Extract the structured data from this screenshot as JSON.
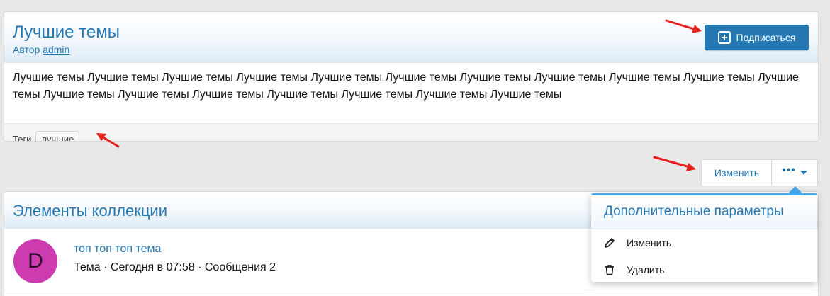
{
  "thread": {
    "title": "Лучшие темы",
    "byline_prefix": "Автор",
    "author": "admin",
    "subscribe_label": "Подписаться",
    "body": "Лучшие темы Лучшие темы Лучшие темы Лучшие темы Лучшие темы Лучшие темы Лучшие темы Лучшие темы Лучшие темы Лучшие темы Лучшие темы Лучшие темы Лучшие темы Лучшие темы Лучшие темы Лучшие темы Лучшие темы Лучшие темы",
    "tags_label": "Теги",
    "tags": [
      "лучшие"
    ]
  },
  "actions": {
    "edit_label": "Изменить",
    "more_label": "•••"
  },
  "collection": {
    "title": "Элементы коллекции",
    "items": [
      {
        "avatar_letter": "D",
        "title": "топ топ топ тема",
        "meta": "Тема · Сегодня в 07:58 · Сообщения 2"
      }
    ]
  },
  "menu": {
    "title": "Дополнительные параметры",
    "items": [
      {
        "label": "Изменить",
        "icon": "pencil-icon"
      },
      {
        "label": "Удалить",
        "icon": "trash-icon"
      }
    ]
  },
  "colors": {
    "accent": "#2577b1",
    "avatar": "#cc3cb0",
    "annotation_arrow": "#e8201c"
  }
}
